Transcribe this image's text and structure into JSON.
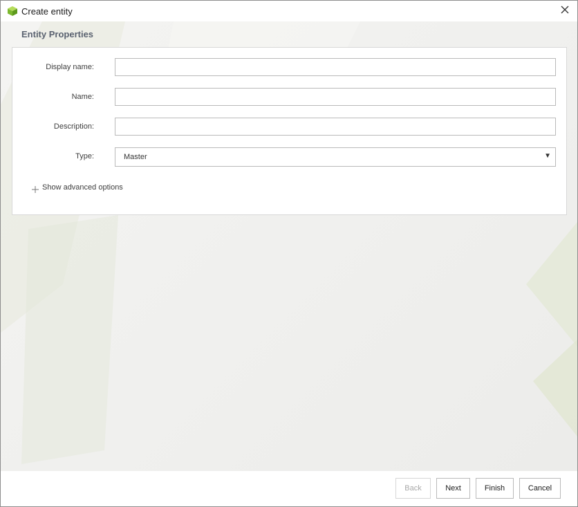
{
  "window": {
    "title": "Create entity",
    "app_icon": "entity-cube-icon",
    "close_icon": "close-icon"
  },
  "section": {
    "title": "Entity Properties"
  },
  "form": {
    "display_name": {
      "label": "Display name:",
      "value": "",
      "placeholder": ""
    },
    "name": {
      "label": "Name:",
      "value": "",
      "placeholder": ""
    },
    "description": {
      "label": "Description:",
      "value": "",
      "placeholder": ""
    },
    "type": {
      "label": "Type:",
      "value": "Master"
    }
  },
  "advanced": {
    "label": "Show advanced options",
    "icon": "plus-icon"
  },
  "buttons": {
    "back": {
      "label": "Back",
      "enabled": false
    },
    "next": {
      "label": "Next"
    },
    "finish": {
      "label": "Finish"
    },
    "cancel": {
      "label": "Cancel"
    }
  },
  "colors": {
    "accent": "#8dc63f",
    "section_title": "#5a6270",
    "disabled_text": "#a8a8a8"
  }
}
